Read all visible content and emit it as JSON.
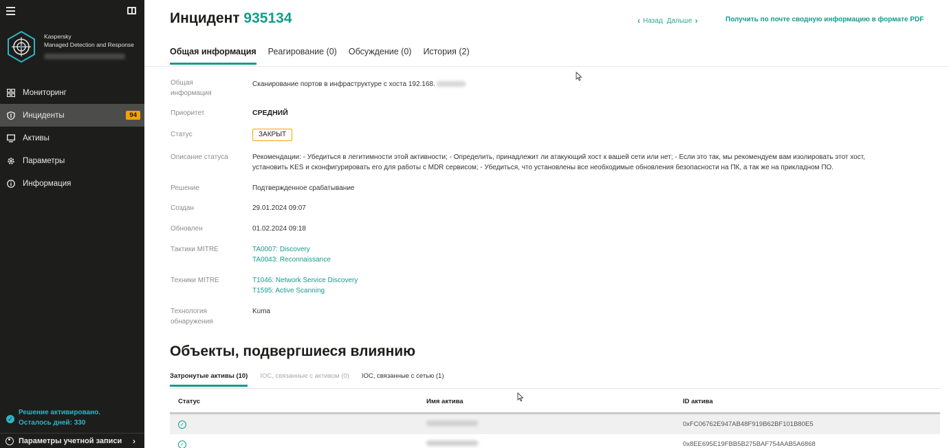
{
  "sidebar": {
    "brand_line1": "Kaspersky",
    "brand_line2": "Managed Detection and Response",
    "items": [
      {
        "label": "Мониторинг",
        "icon": "dashboard-icon"
      },
      {
        "label": "Инциденты",
        "icon": "shield-icon",
        "badge": "94"
      },
      {
        "label": "Активы",
        "icon": "monitor-icon"
      },
      {
        "label": "Параметры",
        "icon": "gear-icon"
      },
      {
        "label": "Информация",
        "icon": "info-icon"
      }
    ],
    "license_line1": "Решение активировано.",
    "license_line2": "Осталось дней: 330",
    "account_label": "Параметры учетной записи"
  },
  "header": {
    "title_prefix": "Инцидент",
    "incident_id": "935134",
    "back_label": "Назад",
    "next_label": "Дальше",
    "pdf_label": "Получить по почте сводную информацию в формате PDF"
  },
  "tabs": [
    "Общая информация",
    "Реагирование (0)",
    "Обсуждение (0)",
    "История (2)"
  ],
  "details": {
    "general_label": "Общая информация",
    "general_value": "Сканирование портов в инфраструктуре с хоста 192.168.",
    "priority_label": "Приоритет",
    "priority_value": "СРЕДНИЙ",
    "status_label": "Статус",
    "status_value": "ЗАКРЫТ",
    "status_desc_label": "Описание статуса",
    "status_desc_line1": "Рекомендации: - Убедиться в легитимности этой активности; - Определить, принадлежит ли атакующий хост к вашей сети или нет; - Если это так, мы рекомендуем вам изолировать этот хост,",
    "status_desc_line2": "установить KES и сконфигурировать его для работы с MDR сервисом; - Убедиться, что установлены все необходимые обновления безопасности на ПК, а так же на прикладном ПО.",
    "resolution_label": "Решение",
    "resolution_value": "Подтвержденное срабатывание",
    "created_label": "Создан",
    "created_value": "29.01.2024 09:07",
    "updated_label": "Обновлен",
    "updated_value": "01.02.2024 09:18",
    "tactics_label": "Тактики MITRE",
    "tactics": [
      "TA0007: Discovery",
      "TA0043: Reconnaissance"
    ],
    "techniques_label": "Техники MITRE",
    "techniques": [
      "T1046: Network Service Discovery",
      "T1595: Active Scanning"
    ],
    "detection_label": "Технология обнаружения",
    "detection_value": "Kuma"
  },
  "objects": {
    "title": "Объекты, подвергшиеся влиянию",
    "subtabs": [
      "Затронутые активы (10)",
      "IOC, связанные с активом (0)",
      "IOC, связанные с сетью (1)"
    ],
    "columns": [
      "Статус",
      "Имя актива",
      "ID актива"
    ],
    "rows": [
      {
        "id": "0xFC06762E947AB48F919B62BF101B80E5"
      },
      {
        "id": "0x8EE695E19FBB5B275BAF754AAB5A6868"
      }
    ]
  },
  "colors": {
    "accent": "#149c8c",
    "badge": "#f5a200",
    "sidebar": "#1d1d1b"
  }
}
